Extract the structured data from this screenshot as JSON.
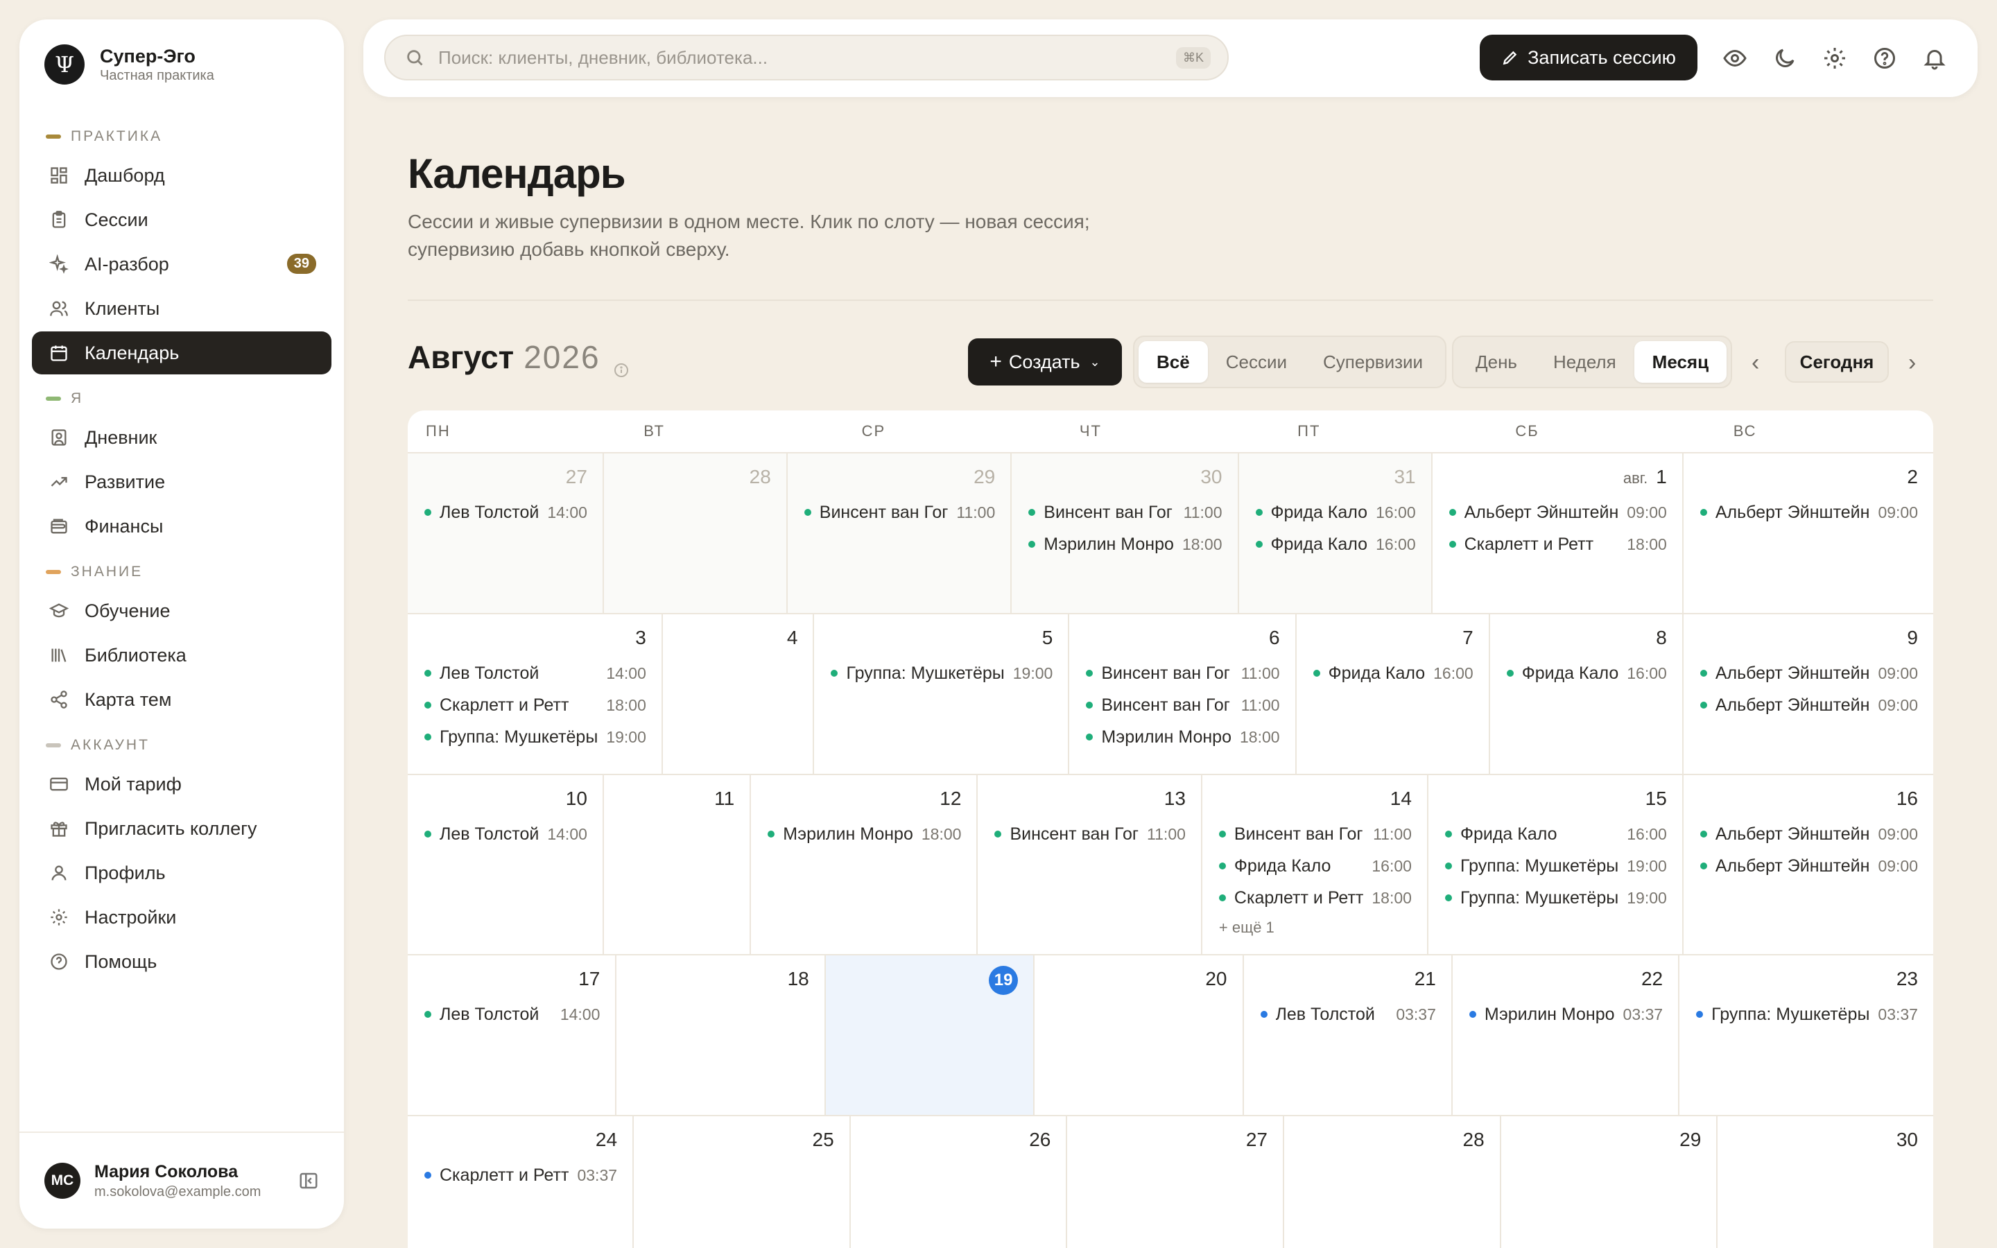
{
  "brand": {
    "title": "Супер-Эго",
    "subtitle": "Частная практика",
    "logo": "Ψ"
  },
  "nav": {
    "sections": [
      {
        "label": "ПРАКТИКА",
        "color": "#a8893a",
        "items": [
          {
            "label": "Дашборд",
            "icon": "dashboard-icon"
          },
          {
            "label": "Сессии",
            "icon": "clipboard-icon"
          },
          {
            "label": "AI-разбор",
            "icon": "sparkles-icon",
            "badge": "39"
          },
          {
            "label": "Клиенты",
            "icon": "users-icon"
          },
          {
            "label": "Календарь",
            "icon": "calendar-icon",
            "active": true
          }
        ]
      },
      {
        "label": "Я",
        "color": "#8fb874",
        "items": [
          {
            "label": "Дневник",
            "icon": "diary-icon"
          },
          {
            "label": "Развитие",
            "icon": "trending-icon"
          },
          {
            "label": "Финансы",
            "icon": "wallet-icon"
          }
        ]
      },
      {
        "label": "ЗНАНИЕ",
        "color": "#e0a35c",
        "items": [
          {
            "label": "Обучение",
            "icon": "graduation-icon"
          },
          {
            "label": "Библиотека",
            "icon": "library-icon"
          },
          {
            "label": "Карта тем",
            "icon": "share-icon"
          }
        ]
      },
      {
        "label": "АККАУНТ",
        "color": "#c9c4bb",
        "items": [
          {
            "label": "Мой тариф",
            "icon": "credit-card-icon"
          },
          {
            "label": "Пригласить коллегу",
            "icon": "gift-icon"
          },
          {
            "label": "Профиль",
            "icon": "user-icon"
          },
          {
            "label": "Настройки",
            "icon": "gear-icon"
          },
          {
            "label": "Помощь",
            "icon": "help-icon"
          }
        ]
      }
    ]
  },
  "user": {
    "initials": "МС",
    "name": "Мария Соколова",
    "email": "m.sokolova@example.com"
  },
  "topbar": {
    "search_placeholder": "Поиск: клиенты, дневник, библиотека...",
    "search_shortcut": "⌘K",
    "record_label": "Записать сессию"
  },
  "page": {
    "title": "Календарь",
    "description": "Сессии и живые супервизии в одном месте. Клик по слоту — новая сессия; супервизию добавь кнопкой сверху."
  },
  "toolbar": {
    "month": "Август",
    "year": "2026",
    "create_label": "Создать",
    "filters": [
      "Всё",
      "Сессии",
      "Супервизии"
    ],
    "filter_selected": "Всё",
    "views": [
      "День",
      "Неделя",
      "Месяц"
    ],
    "view_selected": "Месяц",
    "today_label": "Сегодня"
  },
  "colors": {
    "session": "#1fae7a",
    "upcoming": "#2a7ae2",
    "today": "#2a7ae2"
  },
  "calendar": {
    "weekdays": [
      "ПН",
      "ВТ",
      "СР",
      "ЧТ",
      "ПТ",
      "СБ",
      "ВС"
    ],
    "weeks": [
      {
        "days": [
          {
            "num": "27",
            "out": true,
            "events": [
              {
                "name": "Лев Толстой",
                "time": "14:00",
                "kind": "session"
              }
            ]
          },
          {
            "num": "28",
            "out": true,
            "events": []
          },
          {
            "num": "29",
            "out": true,
            "events": [
              {
                "name": "Винсент ван Гог",
                "time": "11:00",
                "kind": "session"
              }
            ]
          },
          {
            "num": "30",
            "out": true,
            "events": [
              {
                "name": "Винсент ван Гог",
                "time": "11:00",
                "kind": "session"
              },
              {
                "name": "Мэрилин Монро",
                "time": "18:00",
                "kind": "session"
              }
            ]
          },
          {
            "num": "31",
            "out": true,
            "events": [
              {
                "name": "Фрида Кало",
                "time": "16:00",
                "kind": "session"
              },
              {
                "name": "Фрида Кало",
                "time": "16:00",
                "kind": "session"
              }
            ]
          },
          {
            "num": "1",
            "month_label": "авг.",
            "events": [
              {
                "name": "Альберт Эйнштейн",
                "time": "09:00",
                "kind": "session"
              },
              {
                "name": "Скарлетт и Ретт",
                "time": "18:00",
                "kind": "session"
              }
            ]
          },
          {
            "num": "2",
            "events": [
              {
                "name": "Альберт Эйнштейн",
                "time": "09:00",
                "kind": "session"
              }
            ]
          }
        ]
      },
      {
        "days": [
          {
            "num": "3",
            "events": [
              {
                "name": "Лев Толстой",
                "time": "14:00",
                "kind": "session"
              },
              {
                "name": "Скарлетт и Ретт",
                "time": "18:00",
                "kind": "session"
              },
              {
                "name": "Группа: Мушкетёры",
                "time": "19:00",
                "kind": "session"
              }
            ]
          },
          {
            "num": "4",
            "events": []
          },
          {
            "num": "5",
            "events": [
              {
                "name": "Группа: Мушкетёры",
                "time": "19:00",
                "kind": "session"
              }
            ]
          },
          {
            "num": "6",
            "events": [
              {
                "name": "Винсент ван Гог",
                "time": "11:00",
                "kind": "session"
              },
              {
                "name": "Винсент ван Гог",
                "time": "11:00",
                "kind": "session"
              },
              {
                "name": "Мэрилин Монро",
                "time": "18:00",
                "kind": "session"
              }
            ]
          },
          {
            "num": "7",
            "events": [
              {
                "name": "Фрида Кало",
                "time": "16:00",
                "kind": "session"
              }
            ]
          },
          {
            "num": "8",
            "events": [
              {
                "name": "Фрида Кало",
                "time": "16:00",
                "kind": "session"
              }
            ]
          },
          {
            "num": "9",
            "events": [
              {
                "name": "Альберт Эйнштейн",
                "time": "09:00",
                "kind": "session"
              },
              {
                "name": "Альберт Эйнштейн",
                "time": "09:00",
                "kind": "session"
              }
            ]
          }
        ]
      },
      {
        "days": [
          {
            "num": "10",
            "events": [
              {
                "name": "Лев Толстой",
                "time": "14:00",
                "kind": "session"
              }
            ]
          },
          {
            "num": "11",
            "events": []
          },
          {
            "num": "12",
            "events": [
              {
                "name": "Мэрилин Монро",
                "time": "18:00",
                "kind": "session"
              }
            ]
          },
          {
            "num": "13",
            "events": [
              {
                "name": "Винсент ван Гог",
                "time": "11:00",
                "kind": "session"
              }
            ]
          },
          {
            "num": "14",
            "events": [
              {
                "name": "Винсент ван Гог",
                "time": "11:00",
                "kind": "session"
              },
              {
                "name": "Фрида Кало",
                "time": "16:00",
                "kind": "session"
              },
              {
                "name": "Скарлетт и Ретт",
                "time": "18:00",
                "kind": "session"
              }
            ],
            "more": "+ ещё 1"
          },
          {
            "num": "15",
            "events": [
              {
                "name": "Фрида Кало",
                "time": "16:00",
                "kind": "session"
              },
              {
                "name": "Группа: Мушкетёры",
                "time": "19:00",
                "kind": "session"
              },
              {
                "name": "Группа: Мушкетёры",
                "time": "19:00",
                "kind": "session"
              }
            ]
          },
          {
            "num": "16",
            "events": [
              {
                "name": "Альберт Эйнштейн",
                "time": "09:00",
                "kind": "session"
              },
              {
                "name": "Альберт Эйнштейн",
                "time": "09:00",
                "kind": "session"
              }
            ]
          }
        ]
      },
      {
        "days": [
          {
            "num": "17",
            "events": [
              {
                "name": "Лев Толстой",
                "time": "14:00",
                "kind": "session"
              }
            ]
          },
          {
            "num": "18",
            "events": []
          },
          {
            "num": "19",
            "today": true,
            "events": []
          },
          {
            "num": "20",
            "events": []
          },
          {
            "num": "21",
            "events": [
              {
                "name": "Лев Толстой",
                "time": "03:37",
                "kind": "upcoming"
              }
            ]
          },
          {
            "num": "22",
            "events": [
              {
                "name": "Мэрилин Монро",
                "time": "03:37",
                "kind": "upcoming"
              }
            ]
          },
          {
            "num": "23",
            "events": [
              {
                "name": "Группа: Мушкетёры",
                "time": "03:37",
                "kind": "upcoming"
              }
            ]
          }
        ]
      },
      {
        "days": [
          {
            "num": "24",
            "events": [
              {
                "name": "Скарлетт и Ретт",
                "time": "03:37",
                "kind": "upcoming"
              }
            ]
          },
          {
            "num": "25",
            "events": []
          },
          {
            "num": "26",
            "events": []
          },
          {
            "num": "27",
            "events": []
          },
          {
            "num": "28",
            "events": []
          },
          {
            "num": "29",
            "events": []
          },
          {
            "num": "30",
            "events": []
          }
        ]
      }
    ]
  }
}
